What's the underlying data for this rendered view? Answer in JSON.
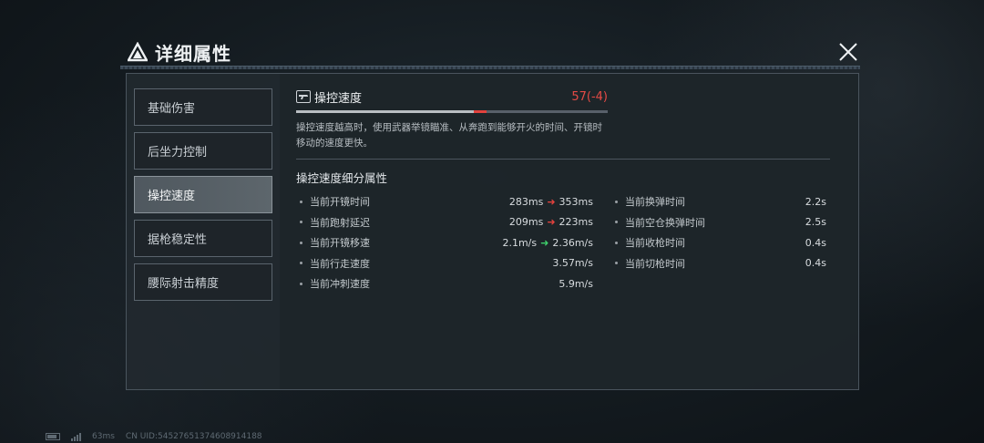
{
  "header": {
    "title": "详细属性",
    "close_icon": "close-icon",
    "title_icon": "triangle-logo-icon"
  },
  "sidebar": {
    "items": [
      {
        "label": "基础伤害",
        "active": false
      },
      {
        "label": "后坐力控制",
        "active": false
      },
      {
        "label": "操控速度",
        "active": true
      },
      {
        "label": "据枪稳定性",
        "active": false
      },
      {
        "label": "腰际射击精度",
        "active": false
      }
    ]
  },
  "stat": {
    "name": "操控速度",
    "value": "57(-4)",
    "bar_value": 57,
    "bar_previous": 61,
    "bar_max": 100,
    "description": "操控速度越高时，使用武器举镜瞄准、从奔跑到能够开火的时间、开镜时移动的速度更快。",
    "icon": "gun-icon"
  },
  "breakdown": {
    "title": "操控速度细分属性",
    "left": [
      {
        "label": "当前开镜时间",
        "from": "283ms",
        "arrow": "red",
        "to": "353ms"
      },
      {
        "label": "当前跑射延迟",
        "from": "209ms",
        "arrow": "red",
        "to": "223ms"
      },
      {
        "label": "当前开镜移速",
        "from": "2.1m/s",
        "arrow": "green",
        "to": "2.36m/s"
      },
      {
        "label": "当前行走速度",
        "from": "",
        "arrow": "",
        "to": "3.57m/s"
      },
      {
        "label": "当前冲刺速度",
        "from": "",
        "arrow": "",
        "to": "5.9m/s"
      }
    ],
    "right": [
      {
        "label": "当前换弹时间",
        "to": "2.2s"
      },
      {
        "label": "当前空仓换弹时间",
        "to": "2.5s"
      },
      {
        "label": "当前收枪时间",
        "to": "0.4s"
      },
      {
        "label": "当前切枪时间",
        "to": "0.4s"
      }
    ]
  },
  "footer": {
    "ping": "63ms",
    "uid": "CN UID:545276513746089141​88"
  },
  "colors": {
    "negative": "#e2423d",
    "positive": "#3ecf6b",
    "active_tab": "#5d666c"
  }
}
